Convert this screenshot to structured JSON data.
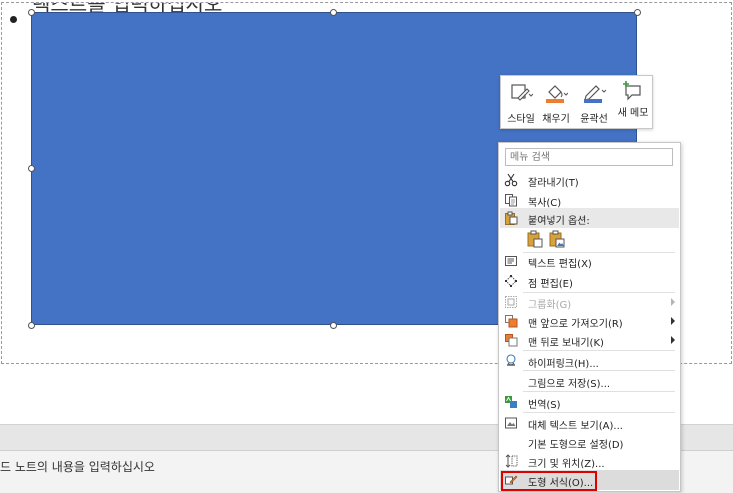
{
  "slide": {
    "bullet_text": "텍스트를 입력하십시오"
  },
  "notes": {
    "text": "드 노트의 내용을 입력하십시오"
  },
  "colors": {
    "shape_fill": "#4472C4",
    "fill_accent": "#ED7D31",
    "outline_accent": "#4472C4",
    "highlight": "#E00000"
  },
  "mini_toolbar": {
    "style_label": "스타일",
    "fill_label": "채우기",
    "outline_label": "윤곽선",
    "memo_label": "새 메모"
  },
  "context_menu": {
    "search_placeholder": "메뉴 검색",
    "items": [
      {
        "label": "잘라내기(T)",
        "icon": "scissors-icon"
      },
      {
        "label": "복사(C)",
        "icon": "copy-icon"
      },
      {
        "label": "붙여넣기 옵션:",
        "icon": "paste-icon"
      },
      {
        "label": "텍스트 편집(X)",
        "icon": "edit-text-icon"
      },
      {
        "label": "점 편집(E)",
        "icon": "edit-points-icon"
      },
      {
        "label": "그룹화(G)",
        "icon": "group-icon"
      },
      {
        "label": "맨 앞으로 가져오기(R)",
        "icon": "bring-to-front-icon"
      },
      {
        "label": "맨 뒤로 보내기(K)",
        "icon": "send-to-back-icon"
      },
      {
        "label": "하이퍼링크(H)...",
        "icon": "hyperlink-icon"
      },
      {
        "label": "그림으로 저장(S)...",
        "icon": ""
      },
      {
        "label": "번역(S)",
        "icon": "translate-icon"
      },
      {
        "label": "대체 텍스트 보기(A)...",
        "icon": "alt-text-icon"
      },
      {
        "label": "기본 도형으로 설정(D)",
        "icon": ""
      },
      {
        "label": "크기 및 위치(Z)...",
        "icon": "size-position-icon"
      },
      {
        "label": "도형 서식(O)...",
        "icon": "format-shape-icon"
      }
    ]
  }
}
